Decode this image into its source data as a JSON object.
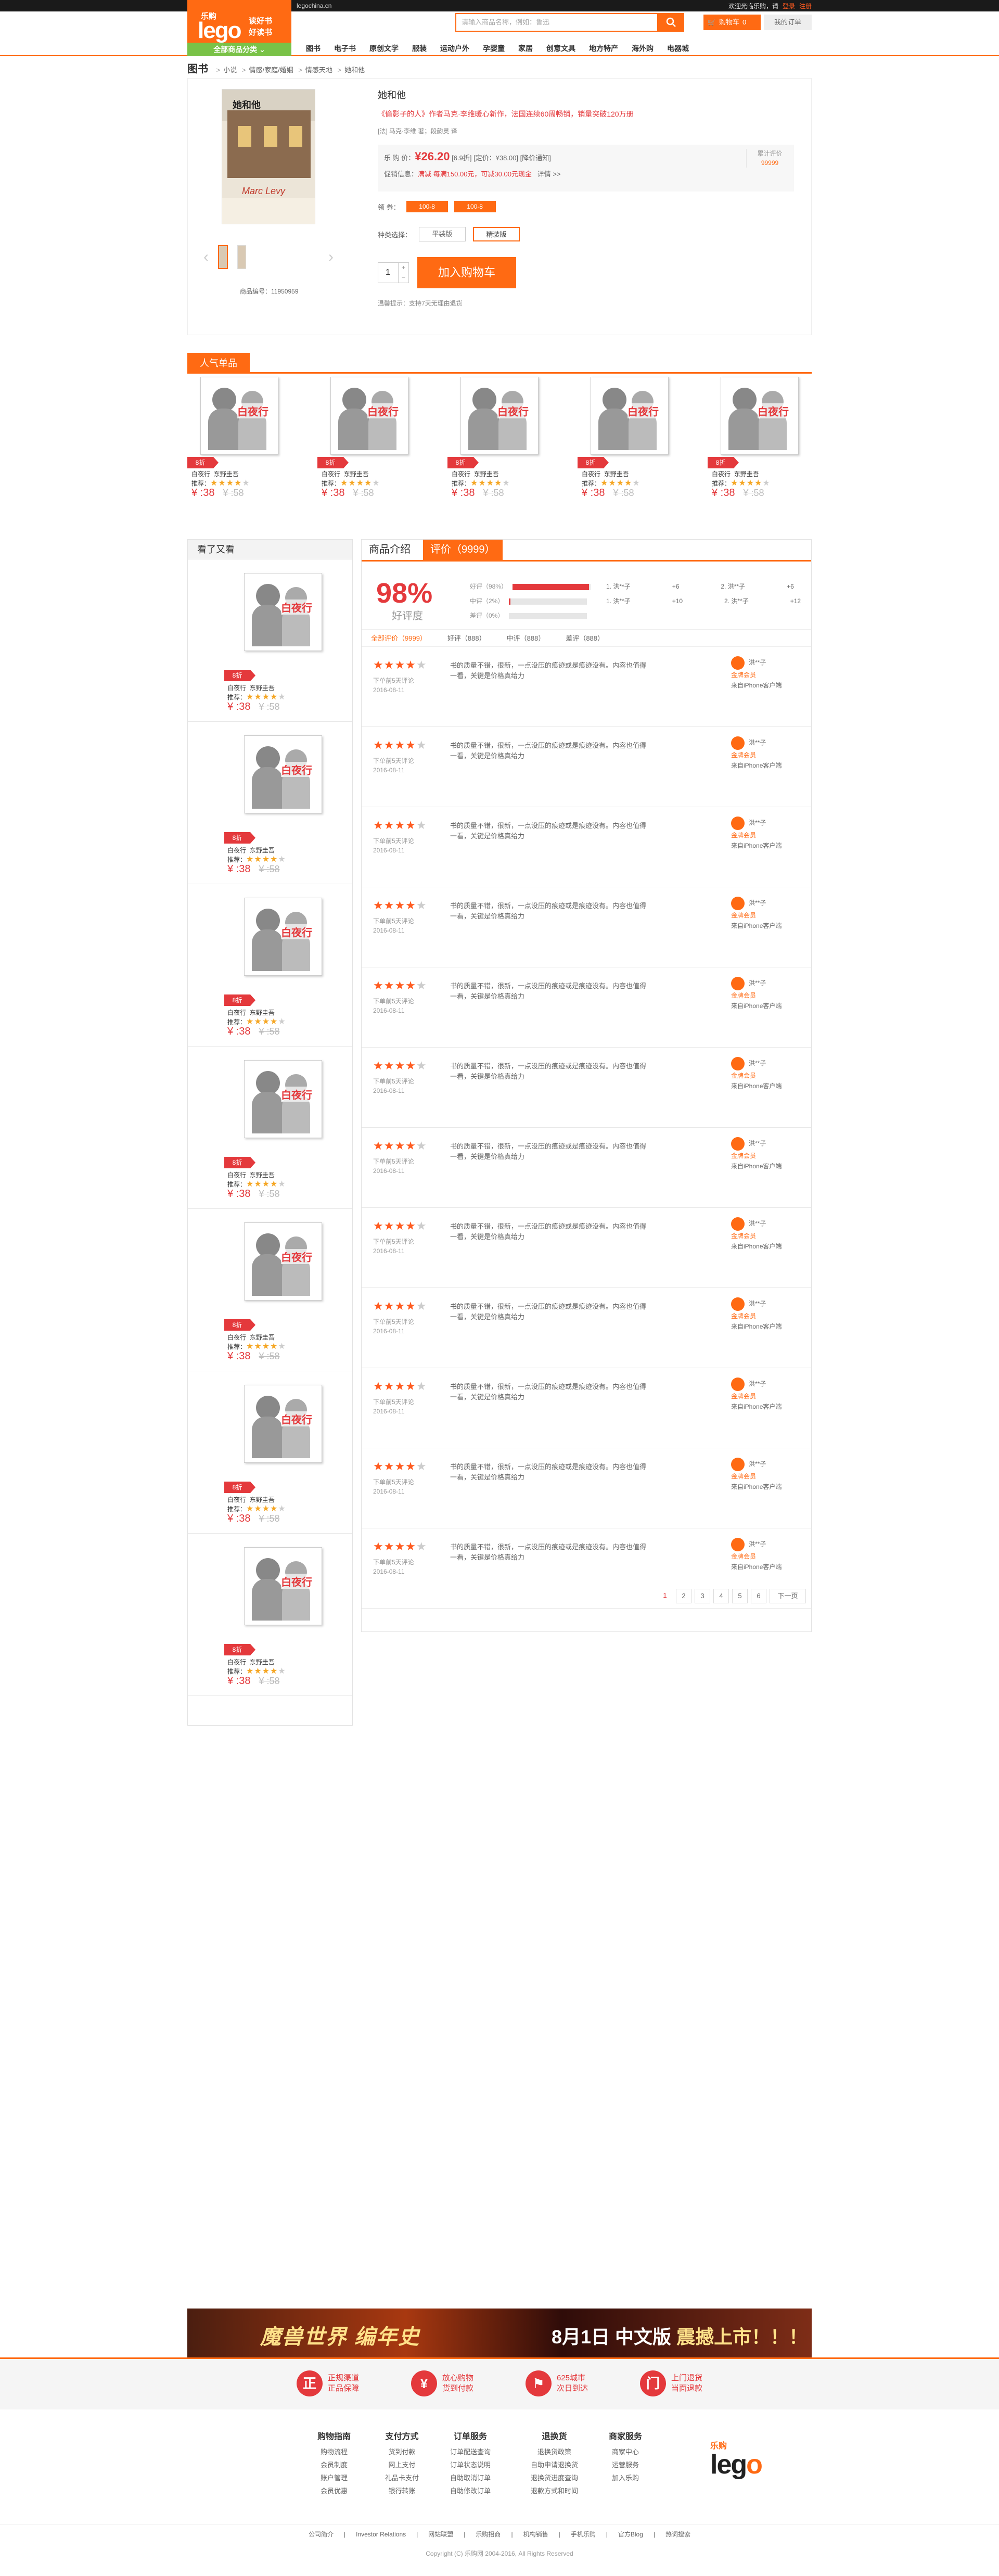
{
  "topbar": {
    "domain": "legochina.cn",
    "welcome": "欢迎光临乐购，请",
    "login": "登录",
    "register": "注册"
  },
  "header": {
    "logo_cn": "乐购",
    "logo_brand": "lego",
    "slogan1": "读好书",
    "slogan2": "好读书",
    "category_all": "全部商品分类",
    "search_placeholder": "请输入商品名称，例如：鲁迅",
    "cart_label": "购物车",
    "cart_count": "0",
    "orders": "我的订单",
    "nav": [
      "图书",
      "电子书",
      "原创文学",
      "服装",
      "运动户外",
      "孕婴童",
      "家居",
      "创意文具",
      "地方特产",
      "海外购",
      "电器城"
    ]
  },
  "crumb": {
    "root": "图书",
    "items": [
      "小说",
      "情感/家庭/婚姻",
      "情感天地",
      "她和他"
    ]
  },
  "product": {
    "cover_title": "她和他",
    "cover_author": "Marc Levy",
    "title": "她和他",
    "subtitle": "《偷影子的人》作者马克·李维暖心新作，法国连续60周畅销，销量突破120万册",
    "author": "[法] 马克·李维 著；段韵灵 译",
    "price_label": "乐 购 价：",
    "price": "¥26.20",
    "price_extra": "[6.9折] [定价：¥38.00] [降价通知]",
    "promo_label": "促销信息：",
    "promo_tag": "满减",
    "promo_text": "每满150.00元，可减30.00元现金",
    "promo_more": "详情 >>",
    "rating_label": "累计评价",
    "rating_value": "99999",
    "coupon_label": "领 券：",
    "coupons": [
      "100-8",
      "100-8"
    ],
    "type_label": "种类选择：",
    "types": [
      "平装版",
      "精装版"
    ],
    "qty": "1",
    "add_cart": "加入购物车",
    "tips": "温馨提示：支持7天无理由退货",
    "sku": "商品编号：11950959"
  },
  "hot": {
    "label": "人气单品",
    "items": [
      {
        "discount": "8折",
        "title": "白夜行",
        "author": "东野圭吾",
        "rec": "推荐：",
        "price": "¥ :38",
        "old": "¥ :58"
      },
      {
        "discount": "8折",
        "title": "白夜行",
        "author": "东野圭吾",
        "rec": "推荐：",
        "price": "¥ :38",
        "old": "¥ :58"
      },
      {
        "discount": "8折",
        "title": "白夜行",
        "author": "东野圭吾",
        "rec": "推荐：",
        "price": "¥ :38",
        "old": "¥ :58"
      },
      {
        "discount": "8折",
        "title": "白夜行",
        "author": "东野圭吾",
        "rec": "推荐：",
        "price": "¥ :38",
        "old": "¥ :58"
      },
      {
        "discount": "8折",
        "title": "白夜行",
        "author": "东野圭吾",
        "rec": "推荐：",
        "price": "¥ :38",
        "old": "¥ :58"
      }
    ],
    "cover_text": "白夜行"
  },
  "side": {
    "title": "看了又看",
    "items": [
      {
        "discount": "8折",
        "title": "白夜行",
        "author": "东野圭吾",
        "rec": "推荐：",
        "price": "¥ :38",
        "old": "¥ :58"
      },
      {
        "discount": "8折",
        "title": "白夜行",
        "author": "东野圭吾",
        "rec": "推荐：",
        "price": "¥ :38",
        "old": "¥ :58"
      },
      {
        "discount": "8折",
        "title": "白夜行",
        "author": "东野圭吾",
        "rec": "推荐：",
        "price": "¥ :38",
        "old": "¥ :58"
      },
      {
        "discount": "8折",
        "title": "白夜行",
        "author": "东野圭吾",
        "rec": "推荐：",
        "price": "¥ :38",
        "old": "¥ :58"
      },
      {
        "discount": "8折",
        "title": "白夜行",
        "author": "东野圭吾",
        "rec": "推荐：",
        "price": "¥ :38",
        "old": "¥ :58"
      },
      {
        "discount": "8折",
        "title": "白夜行",
        "author": "东野圭吾",
        "rec": "推荐：",
        "price": "¥ :38",
        "old": "¥ :58"
      },
      {
        "discount": "8折",
        "title": "白夜行",
        "author": "东野圭吾",
        "rec": "推荐：",
        "price": "¥ :38",
        "old": "¥ :58"
      }
    ]
  },
  "reviews": {
    "tab_intro": "商品介绍",
    "tab_reviews": "评价（9999）",
    "percent": "98%",
    "percent_label": "好评度",
    "bars": [
      {
        "label": "好评（98%）",
        "pct": 0.98
      },
      {
        "label": "中评（2%）",
        "pct": 0.02
      },
      {
        "label": "差评（0%）",
        "pct": 0
      }
    ],
    "mini": [
      [
        "1. 洪**子",
        "+6",
        "2. 洪**子",
        "+6"
      ],
      [
        "1. 洪**子",
        "+10",
        "2. 洪**子",
        "+12"
      ]
    ],
    "filters": [
      "全部评价（9999）",
      "好评（888）",
      "中评（888）",
      "差评（888）"
    ],
    "items": [
      {
        "stars": 4,
        "by": "下单前5天评论",
        "date": "2016-08-11",
        "text": "书的质量不错，很新，一点没压的痕迹或是痕迹没有。内容也值得一看，关键是价格真给力",
        "user": "洪**子",
        "level": "金牌会员",
        "source": "来自iPhone客户端"
      },
      {
        "stars": 4,
        "by": "下单前5天评论",
        "date": "2016-08-11",
        "text": "书的质量不错，很新，一点没压的痕迹或是痕迹没有。内容也值得一看，关键是价格真给力",
        "user": "洪**子",
        "level": "金牌会员",
        "source": "来自iPhone客户端"
      },
      {
        "stars": 4,
        "by": "下单前5天评论",
        "date": "2016-08-11",
        "text": "书的质量不错，很新，一点没压的痕迹或是痕迹没有。内容也值得一看，关键是价格真给力",
        "user": "洪**子",
        "level": "金牌会员",
        "source": "来自iPhone客户端"
      },
      {
        "stars": 4,
        "by": "下单前5天评论",
        "date": "2016-08-11",
        "text": "书的质量不错，很新，一点没压的痕迹或是痕迹没有。内容也值得一看，关键是价格真给力",
        "user": "洪**子",
        "level": "金牌会员",
        "source": "来自iPhone客户端"
      },
      {
        "stars": 4,
        "by": "下单前5天评论",
        "date": "2016-08-11",
        "text": "书的质量不错，很新，一点没压的痕迹或是痕迹没有。内容也值得一看，关键是价格真给力",
        "user": "洪**子",
        "level": "金牌会员",
        "source": "来自iPhone客户端"
      },
      {
        "stars": 4,
        "by": "下单前5天评论",
        "date": "2016-08-11",
        "text": "书的质量不错，很新，一点没压的痕迹或是痕迹没有。内容也值得一看，关键是价格真给力",
        "user": "洪**子",
        "level": "金牌会员",
        "source": "来自iPhone客户端"
      },
      {
        "stars": 4,
        "by": "下单前5天评论",
        "date": "2016-08-11",
        "text": "书的质量不错，很新，一点没压的痕迹或是痕迹没有。内容也值得一看，关键是价格真给力",
        "user": "洪**子",
        "level": "金牌会员",
        "source": "来自iPhone客户端"
      },
      {
        "stars": 4,
        "by": "下单前5天评论",
        "date": "2016-08-11",
        "text": "书的质量不错，很新，一点没压的痕迹或是痕迹没有。内容也值得一看，关键是价格真给力",
        "user": "洪**子",
        "level": "金牌会员",
        "source": "来自iPhone客户端"
      },
      {
        "stars": 4,
        "by": "下单前5天评论",
        "date": "2016-08-11",
        "text": "书的质量不错，很新，一点没压的痕迹或是痕迹没有。内容也值得一看，关键是价格真给力",
        "user": "洪**子",
        "level": "金牌会员",
        "source": "来自iPhone客户端"
      },
      {
        "stars": 4,
        "by": "下单前5天评论",
        "date": "2016-08-11",
        "text": "书的质量不错，很新，一点没压的痕迹或是痕迹没有。内容也值得一看，关键是价格真给力",
        "user": "洪**子",
        "level": "金牌会员",
        "source": "来自iPhone客户端"
      },
      {
        "stars": 4,
        "by": "下单前5天评论",
        "date": "2016-08-11",
        "text": "书的质量不错，很新，一点没压的痕迹或是痕迹没有。内容也值得一看，关键是价格真给力",
        "user": "洪**子",
        "level": "金牌会员",
        "source": "来自iPhone客户端"
      },
      {
        "stars": 4,
        "by": "下单前5天评论",
        "date": "2016-08-11",
        "text": "书的质量不错，很新，一点没压的痕迹或是痕迹没有。内容也值得一看，关键是价格真给力",
        "user": "洪**子",
        "level": "金牌会员",
        "source": "来自iPhone客户端"
      }
    ],
    "pages": [
      "1",
      "2",
      "3",
      "4",
      "5",
      "6",
      "下一页"
    ]
  },
  "banner": {
    "left": "魔兽世界 编年史",
    "right_a": "8月1日 中文版 ",
    "right_b": "震撼上市！！！"
  },
  "guarantees": [
    {
      "icon": "正",
      "l1": "正规渠道",
      "l2": "正品保障"
    },
    {
      "icon": "¥",
      "l1": "放心购物",
      "l2": "货到付款"
    },
    {
      "icon": "⚑",
      "l1": "625城市",
      "l2": "次日到达"
    },
    {
      "icon": "门",
      "l1": "上门退货",
      "l2": "当面退款"
    }
  ],
  "footer": {
    "cols": [
      {
        "title": "购物指南",
        "items": [
          "购物流程",
          "会员制度",
          "账户管理",
          "会员优惠"
        ]
      },
      {
        "title": "支付方式",
        "items": [
          "货到付款",
          "网上支付",
          "礼品卡支付",
          "银行转账"
        ]
      },
      {
        "title": "订单服务",
        "items": [
          "订单配送查询",
          "订单状态说明",
          "自助取消订单",
          "自助修改订单"
        ]
      },
      {
        "title": "退换货",
        "items": [
          "退换货政策",
          "自助申请退换货",
          "退换货进度查询",
          "退款方式和时间"
        ]
      },
      {
        "title": "商家服务",
        "items": [
          "商家中心",
          "运营服务",
          "加入乐购"
        ]
      }
    ],
    "logo_cn": "乐购",
    "logo_brand_a": "leg",
    "logo_brand_b": "o",
    "links": [
      "公司简介",
      "Investor Relations",
      "网站联盟",
      "乐购招商",
      "机构销售",
      "手机乐购",
      "官方Blog",
      "热词搜索"
    ],
    "copyright": "Copyright (C) 乐购网 2004-2016, All Rights Reserved"
  }
}
